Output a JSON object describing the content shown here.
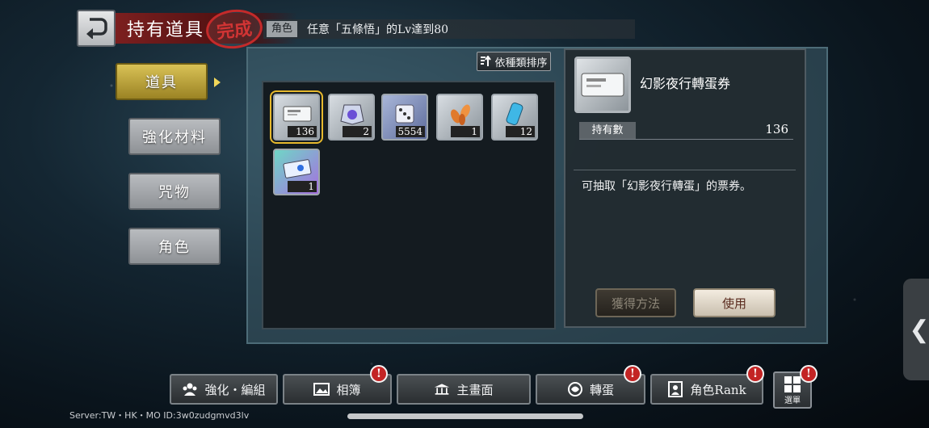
{
  "header": {
    "title": "持有道具",
    "stamp": "完成",
    "mission_tag": "角色",
    "mission_text": "任意「五條悟」的Lv達到80"
  },
  "tabs": [
    {
      "label": "道具",
      "active": true
    },
    {
      "label": "強化材料",
      "active": false
    },
    {
      "label": "咒物",
      "active": false
    },
    {
      "label": "角色",
      "active": false
    }
  ],
  "sort_button": {
    "label": "依種類排序"
  },
  "items": [
    {
      "icon": "ticket-icon",
      "count": "136",
      "selected": true
    },
    {
      "icon": "badge-icon",
      "count": "2",
      "selected": false
    },
    {
      "icon": "dice-icon",
      "count": "5554",
      "selected": false
    },
    {
      "icon": "leaf-icon",
      "count": "1",
      "selected": false
    },
    {
      "icon": "canister-icon",
      "count": "12",
      "selected": false
    },
    {
      "icon": "card-icon",
      "count": "1",
      "selected": false
    }
  ],
  "detail": {
    "name": "幻影夜行轉蛋券",
    "own_label": "持有數",
    "own_value": "136",
    "description": "可抽取「幻影夜行轉蛋」的票券。",
    "acquire_label": "獲得方法",
    "use_label": "使用"
  },
  "bottom_nav": {
    "enhance": "強化・編組",
    "album": "相簿",
    "home": "主畫面",
    "gacha": "轉蛋",
    "rank": "角色Rank",
    "menu": "選單",
    "alert": "!"
  },
  "server_info": "Server:TW・HK・MO ID:3w0zudgmvd3lv",
  "colors": {
    "active_tab": "#d9c256",
    "alert": "#c32424",
    "title_band": "#7c1f1f"
  }
}
